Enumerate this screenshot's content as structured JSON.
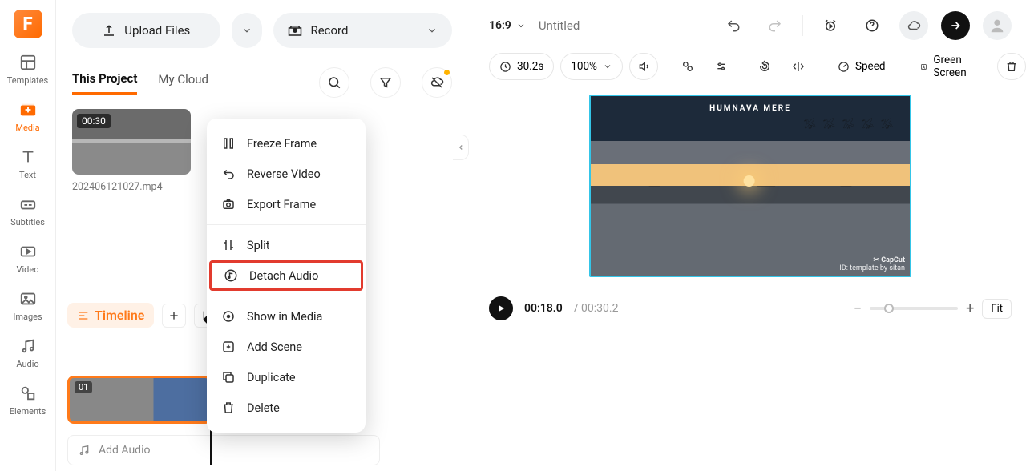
{
  "sidebar": {
    "items": [
      {
        "label": "Templates"
      },
      {
        "label": "Media"
      },
      {
        "label": "Text"
      },
      {
        "label": "Subtitles"
      },
      {
        "label": "Video"
      },
      {
        "label": "Images"
      },
      {
        "label": "Audio"
      },
      {
        "label": "Elements"
      }
    ]
  },
  "header": {
    "upload_label": "Upload Files",
    "record_label": "Record"
  },
  "media_tabs": {
    "this_project": "This Project",
    "my_cloud": "My Cloud"
  },
  "clip": {
    "duration": "00:30",
    "filename": "202406121027.mp4"
  },
  "context_menu": {
    "freeze": "Freeze Frame",
    "reverse": "Reverse Video",
    "export_frame": "Export Frame",
    "split": "Split",
    "detach": "Detach Audio",
    "show_in_media": "Show in Media",
    "add_scene": "Add Scene",
    "duplicate": "Duplicate",
    "delete": "Delete"
  },
  "timeline": {
    "label": "Timeline",
    "scene_num": "01",
    "add_audio": "Add Audio"
  },
  "preview": {
    "ratio": "16:9",
    "title_placeholder": "Untitled",
    "duration_badge": "30.2s",
    "zoom": "100%",
    "speed": "Speed",
    "green_screen": "Green Screen",
    "overlay_text": "HUMNAVA MERE",
    "watermark_app": "✂ CapCut",
    "watermark_credit": "ID: template by sitan",
    "time_now": "00:18.0",
    "time_total": "/ 00:30.2",
    "fit": "Fit"
  }
}
